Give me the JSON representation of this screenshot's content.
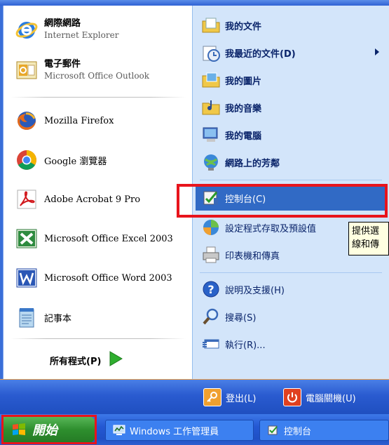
{
  "left": {
    "pinned": [
      {
        "title": "網際網路",
        "sub": "Internet Explorer",
        "icon": "internet-explorer-icon"
      },
      {
        "title": "電子郵件",
        "sub": "Microsoft Office Outlook",
        "icon": "outlook-icon"
      }
    ],
    "recent": [
      {
        "label": "Mozilla Firefox",
        "icon": "firefox-icon"
      },
      {
        "label": "Google 瀏覽器",
        "icon": "chrome-icon"
      },
      {
        "label": "Adobe Acrobat 9 Pro",
        "icon": "acrobat-icon"
      },
      {
        "label": "Microsoft Office Excel 2003",
        "icon": "excel-icon"
      },
      {
        "label": "Microsoft Office Word 2003",
        "icon": "word-icon"
      },
      {
        "label": "記事本",
        "icon": "notepad-icon"
      }
    ],
    "all_programs": "所有程式(P)"
  },
  "right": {
    "items": [
      {
        "label": "我的文件",
        "icon": "my-documents-icon"
      },
      {
        "label": "我最近的文件(D)",
        "icon": "recent-documents-icon"
      },
      {
        "label": "我的圖片",
        "icon": "my-pictures-icon"
      },
      {
        "label": "我的音樂",
        "icon": "my-music-icon"
      },
      {
        "label": "我的電腦",
        "icon": "my-computer-icon"
      },
      {
        "label": "網路上的芳鄰",
        "icon": "network-places-icon"
      },
      {
        "label": "控制台(C)",
        "icon": "control-panel-icon"
      },
      {
        "label": "設定程式存取及預設值",
        "icon": "program-defaults-icon"
      },
      {
        "label": "印表機和傳真",
        "icon": "printers-icon"
      },
      {
        "label": "說明及支援(H)",
        "icon": "help-icon"
      },
      {
        "label": "搜尋(S)",
        "icon": "search-icon"
      },
      {
        "label": "執行(R)...",
        "icon": "run-icon"
      }
    ],
    "tooltip": [
      "提供選",
      "線和傳"
    ]
  },
  "bottom": {
    "logoff": "登出(L)",
    "shutdown": "電腦關機(U)"
  },
  "taskbar": {
    "start": "開始",
    "tasks": [
      "Windows 工作管理員",
      "控制台"
    ]
  },
  "colors": {
    "highlight": "#316ac5",
    "annotation": "#e8141c"
  }
}
